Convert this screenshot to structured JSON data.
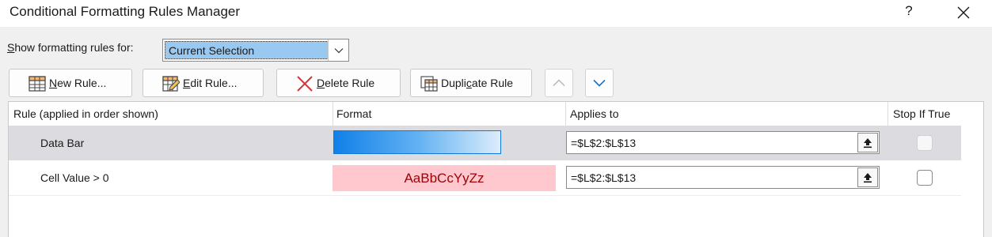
{
  "window": {
    "title": "Conditional Formatting Rules Manager",
    "help": "?"
  },
  "show_rules": {
    "label_prefix": "",
    "label_mnemonic": "S",
    "label_rest": "how formatting rules for:",
    "selected": "Current Selection"
  },
  "toolbar": {
    "new_rule_mn": "N",
    "new_rule_rest": "ew Rule...",
    "edit_rule_mn": "E",
    "edit_rule_rest": "dit Rule...",
    "delete_rule_mn": "D",
    "delete_rule_rest": "elete Rule",
    "duplicate_pre": "Dupli",
    "duplicate_mn": "c",
    "duplicate_rest": "ate Rule"
  },
  "columns": {
    "rule": "Rule (applied in order shown)",
    "format": "Format",
    "applies_to": "Applies to",
    "stop_if_true": "Stop If True"
  },
  "rules": [
    {
      "name": "Data Bar",
      "format_type": "data-bar",
      "applies_to": "=$L$2:$L$13",
      "stop_if_true": false,
      "selected": true
    },
    {
      "name": "Cell Value > 0",
      "format_type": "preview",
      "format_preview": "AaBbCcYyZz",
      "applies_to": "=$L$2:$L$13",
      "stop_if_true": false,
      "selected": false
    }
  ],
  "colors": {
    "selection": "#99c8f0",
    "selected_row": "#dcdce0",
    "databar_start": "#1080e8",
    "preview_fill": "#ffc7ce",
    "preview_text": "#9c0006",
    "delete_red": "#d13438",
    "accent_blue": "#1a6fc4"
  },
  "icons": {
    "new_rule": "table-grid-icon",
    "edit_rule": "table-pencil-icon",
    "delete_rule": "red-x-icon",
    "duplicate_rule": "table-copy-icon",
    "move_up": "chevron-up-icon",
    "move_down": "chevron-down-icon",
    "collapse": "range-collapse-icon"
  }
}
